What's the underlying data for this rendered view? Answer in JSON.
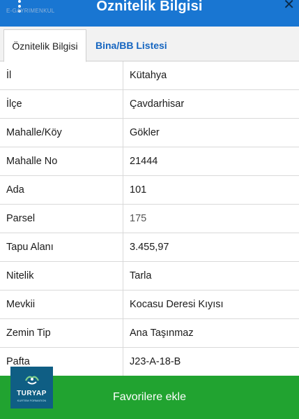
{
  "header": {
    "title": "Öznitelik Bilgisi",
    "subtitle": "E-GAYRIMENKUL",
    "close_symbol": "✕",
    "menu_icon": "more-vertical-icon",
    "background": "#1976d2"
  },
  "tabs": [
    {
      "label": "Öznitelik Bilgisi",
      "active": true
    },
    {
      "label": "Bina/BB Listesi",
      "active": false
    }
  ],
  "table": {
    "rows": [
      {
        "key": "İl",
        "value": "Kütahya"
      },
      {
        "key": "İlçe",
        "value": "Çavdarhisar"
      },
      {
        "key": "Mahalle/Köy",
        "value": "Gökler"
      },
      {
        "key": "Mahalle No",
        "value": "21444"
      },
      {
        "key": "Ada",
        "value": "101"
      },
      {
        "key": "Parsel",
        "value": "175"
      },
      {
        "key": "Tapu Alanı",
        "value": "3.455,97"
      },
      {
        "key": "Nitelik",
        "value": "Tarla"
      },
      {
        "key": "Mevkii",
        "value": "Kocasu Deresi Kıyısı"
      },
      {
        "key": "Zemin Tip",
        "value": "Ana Taşınmaz"
      },
      {
        "key": "Pafta",
        "value": "J23-A-18-B"
      }
    ]
  },
  "footer": {
    "button_label": "Favorilere ekle",
    "background": "#21a330"
  },
  "logo": {
    "name": "TURYAP",
    "tagline": "KURTEM FORMATION"
  }
}
